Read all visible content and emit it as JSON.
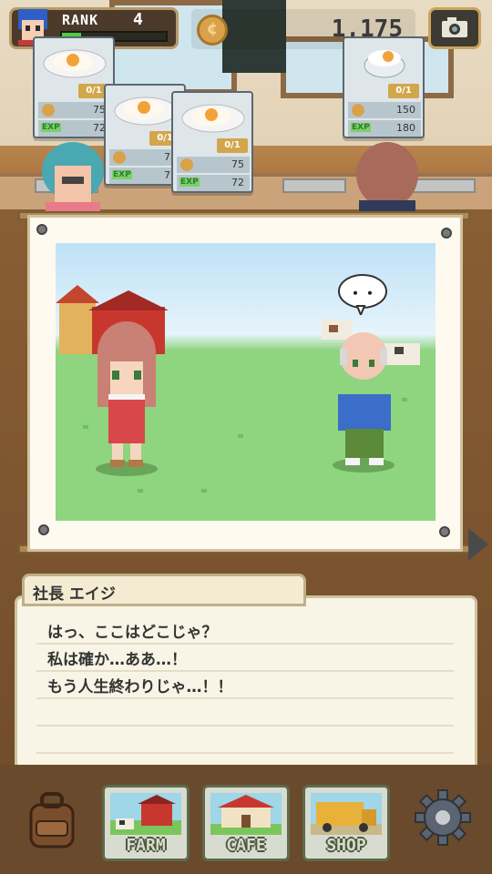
{
  "hud": {
    "rank_label": "RANK",
    "rank_value": "4",
    "rank_progress": 0.18,
    "coins": "1,175"
  },
  "orders": [
    {
      "qty": "0/1",
      "coin": "75",
      "exp_label": "EXP",
      "exp": "72"
    },
    {
      "qty": "0/1",
      "coin": "75",
      "exp_label": "EXP",
      "exp": "72"
    },
    {
      "qty": "0/1",
      "coin": "75",
      "exp_label": "EXP",
      "exp": "72"
    },
    {
      "qty": "0/1",
      "coin": "150",
      "exp_label": "EXP",
      "exp": "180"
    }
  ],
  "dialog": {
    "speaker": "社長 エイジ",
    "lines": [
      "はっ、ここはどこじゃ？",
      "私は確か…ああ…！",
      "もう人生終わりじゃ…！！"
    ]
  },
  "speech_bubble": "・・",
  "nav": {
    "farm": "FARM",
    "cafe": "CAFE",
    "shop": "SHOP"
  },
  "colors": {
    "accent_gold": "#d3a64b",
    "exp_green": "#7bd06a",
    "dialog_bg": "#f8f4e6"
  },
  "icons": [
    "backpack-icon",
    "gear-icon",
    "camera-icon",
    "coin-icon"
  ]
}
